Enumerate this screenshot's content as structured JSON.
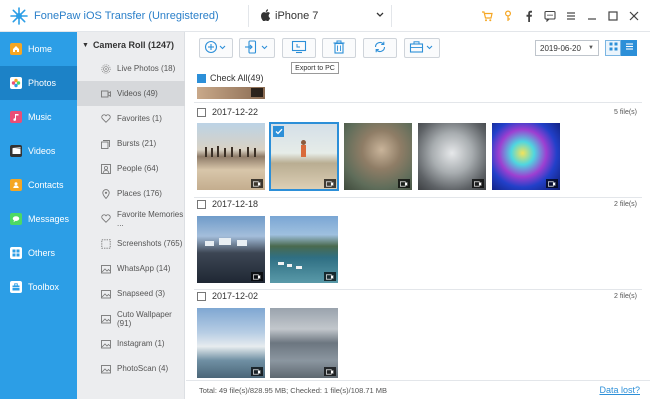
{
  "app": {
    "title": "FonePaw iOS Transfer (Unregistered)",
    "device_name": "iPhone 7"
  },
  "titlebar_icons": [
    "cart-icon",
    "key-icon",
    "facebook-icon",
    "feedback-icon",
    "menu-icon",
    "minimize-icon",
    "maximize-icon",
    "close-icon"
  ],
  "leftnav": {
    "items": [
      {
        "label": "Home",
        "icon": "home-icon",
        "color": "#f5a623",
        "active": false
      },
      {
        "label": "Photos",
        "icon": "photos-icon",
        "color": "#e94e77",
        "active": true
      },
      {
        "label": "Music",
        "icon": "music-icon",
        "color": "#e94e77",
        "active": false
      },
      {
        "label": "Videos",
        "icon": "videos-icon",
        "color": "#333333",
        "active": false
      },
      {
        "label": "Contacts",
        "icon": "contacts-icon",
        "color": "#f5a623",
        "active": false
      },
      {
        "label": "Messages",
        "icon": "messages-icon",
        "color": "#4cd964",
        "active": false
      },
      {
        "label": "Others",
        "icon": "others-icon",
        "color": "#2c9ee6",
        "active": false
      },
      {
        "label": "Toolbox",
        "icon": "toolbox-icon",
        "color": "#2c9ee6",
        "active": false
      }
    ]
  },
  "sidebar": {
    "header": "Camera Roll (1247)",
    "items": [
      {
        "label": "Live Photos (18)",
        "icon": "live-photo-icon",
        "active": false
      },
      {
        "label": "Videos (49)",
        "icon": "video-icon",
        "active": true
      },
      {
        "label": "Favorites (1)",
        "icon": "heart-icon",
        "active": false
      },
      {
        "label": "Bursts (21)",
        "icon": "bursts-icon",
        "active": false
      },
      {
        "label": "People (64)",
        "icon": "people-icon",
        "active": false
      },
      {
        "label": "Places (176)",
        "icon": "location-icon",
        "active": false
      },
      {
        "label": "Favorite Memories ...",
        "icon": "heart-icon",
        "active": false
      },
      {
        "label": "Screenshots (765)",
        "icon": "screenshot-icon",
        "active": false
      },
      {
        "label": "WhatsApp (14)",
        "icon": "album-icon",
        "active": false
      },
      {
        "label": "Snapseed (3)",
        "icon": "album-icon",
        "active": false
      },
      {
        "label": "Cuto Wallpaper (91)",
        "icon": "album-icon",
        "active": false
      },
      {
        "label": "Instagram (1)",
        "icon": "album-icon",
        "active": false
      },
      {
        "label": "PhotoScan (4)",
        "icon": "album-icon",
        "active": false
      }
    ]
  },
  "toolbar": {
    "buttons": [
      "add-icon",
      "export-to-device-icon",
      "export-to-pc-icon",
      "delete-icon",
      "refresh-icon",
      "toolkit-icon"
    ],
    "tooltip": "Export to PC",
    "date_value": "2019-06-20"
  },
  "content": {
    "check_all_label": "Check All(49)",
    "groups": [
      {
        "date": "2017-12-22",
        "count": "5 file(s)",
        "thumb_count": 5
      },
      {
        "date": "2017-12-18",
        "count": "2 file(s)",
        "thumb_count": 2
      },
      {
        "date": "2017-12-02",
        "count": "2 file(s)",
        "thumb_count": 2
      }
    ]
  },
  "status": {
    "summary": "Total: 49 file(s)/828.95 MB; Checked: 1 file(s)/108.71 MB",
    "data_lost_link": "Data lost?"
  },
  "colors": {
    "accent": "#2c9ee6",
    "nav_active": "#1c82c7",
    "sidebar_bg": "#ecedef",
    "title_text": "#2a7fc9"
  }
}
